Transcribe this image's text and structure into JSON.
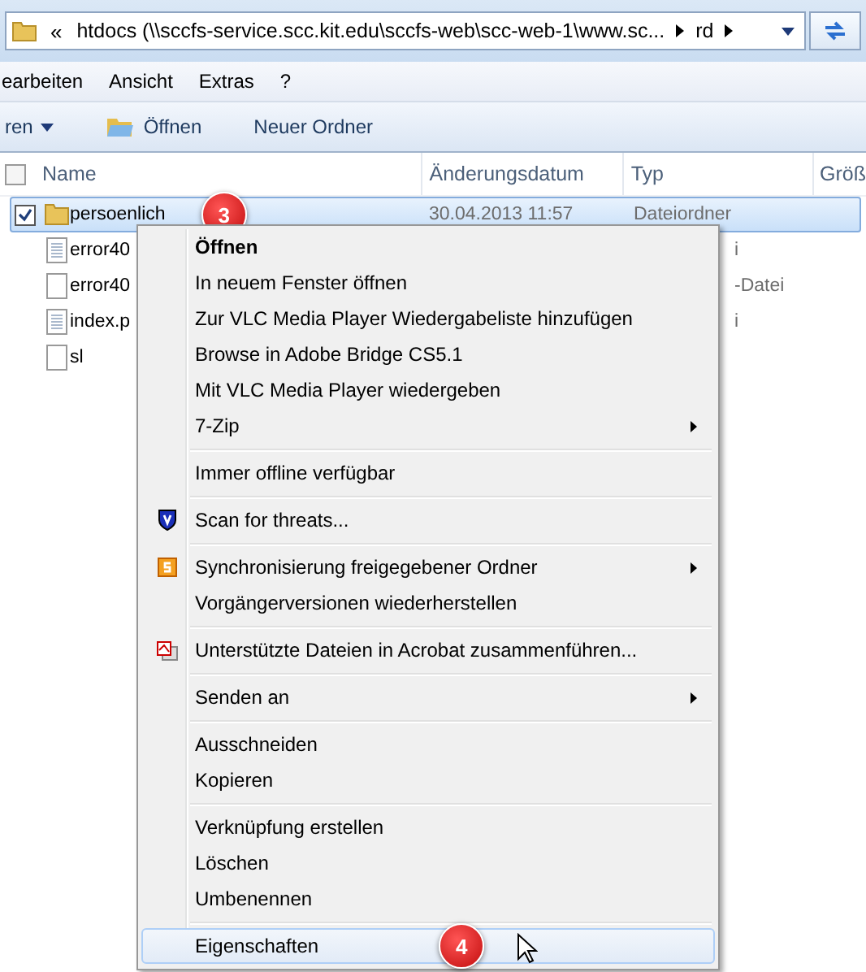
{
  "address_bar": {
    "back_chevron": "«",
    "path": "htdocs (\\\\sccfs-service.scc.kit.edu\\sccfs-web\\scc-web-1\\www.sc...",
    "crumbs": [
      "rd"
    ]
  },
  "menu_bar": [
    "earbeiten",
    "Ansicht",
    "Extras",
    "?"
  ],
  "toolbar": [
    {
      "label": "ren",
      "kind": "dropdown"
    },
    {
      "label": "Öffnen",
      "kind": "open"
    },
    {
      "label": "Neuer Ordner",
      "kind": "plain"
    }
  ],
  "header_checkbox": {
    "checked": false
  },
  "columns": [
    "Name",
    "Änderungsdatum",
    "Typ",
    "Größ"
  ],
  "rows": [
    {
      "name": "persoenlich",
      "date": "30.04.2013 11:57",
      "type": "Dateiordner",
      "kind": "folder",
      "selected": true,
      "checked": true,
      "badge": "3"
    },
    {
      "name": "error40",
      "type_tail": "i",
      "kind": "lines",
      "selected": false,
      "checked": false
    },
    {
      "name": "error40",
      "type_tail": "-Datei",
      "kind": "blank",
      "selected": false,
      "checked": false
    },
    {
      "name": "index.p",
      "type_tail": "i",
      "kind": "lines",
      "selected": false,
      "checked": false
    },
    {
      "name": "sl",
      "kind": "blank",
      "selected": false,
      "checked": false
    }
  ],
  "context_menu": [
    {
      "kind": "item",
      "label": "Öffnen",
      "default": true,
      "submenu": false,
      "selected": false
    },
    {
      "kind": "item",
      "label": "In neuem Fenster öffnen",
      "default": false,
      "submenu": false,
      "selected": false
    },
    {
      "kind": "item",
      "label": "Zur VLC Media Player Wiedergabeliste hinzufügen",
      "default": false,
      "submenu": false,
      "selected": false
    },
    {
      "kind": "item",
      "label": "Browse in Adobe Bridge CS5.1",
      "default": false,
      "submenu": false,
      "selected": false
    },
    {
      "kind": "item",
      "label": "Mit VLC Media Player wiedergeben",
      "default": false,
      "submenu": false,
      "selected": false
    },
    {
      "kind": "item",
      "label": "7-Zip",
      "default": false,
      "submenu": true,
      "selected": false
    },
    {
      "kind": "separator"
    },
    {
      "kind": "item",
      "label": "Immer offline verfügbar",
      "default": false,
      "submenu": false,
      "selected": false
    },
    {
      "kind": "separator"
    },
    {
      "kind": "shield",
      "label": "Scan for threats...",
      "default": false,
      "submenu": false,
      "selected": false
    },
    {
      "kind": "separator"
    },
    {
      "kind": "sync",
      "label": "Synchronisierung freigegebener Ordner",
      "default": false,
      "submenu": true,
      "selected": false
    },
    {
      "kind": "item",
      "label": "Vorgängerversionen wiederherstellen",
      "default": false,
      "submenu": false,
      "selected": false
    },
    {
      "kind": "separator"
    },
    {
      "kind": "acrobat",
      "label": "Unterstützte Dateien in Acrobat zusammenführen...",
      "default": false,
      "submenu": false,
      "selected": false
    },
    {
      "kind": "separator"
    },
    {
      "kind": "item",
      "label": "Senden an",
      "default": false,
      "submenu": true,
      "selected": false
    },
    {
      "kind": "separator"
    },
    {
      "kind": "item",
      "label": "Ausschneiden",
      "default": false,
      "submenu": false,
      "selected": false
    },
    {
      "kind": "item",
      "label": "Kopieren",
      "default": false,
      "submenu": false,
      "selected": false
    },
    {
      "kind": "separator"
    },
    {
      "kind": "item",
      "label": "Verknüpfung erstellen",
      "default": false,
      "submenu": false,
      "selected": false
    },
    {
      "kind": "item",
      "label": "Löschen",
      "default": false,
      "submenu": false,
      "selected": false
    },
    {
      "kind": "item",
      "label": "Umbenennen",
      "default": false,
      "submenu": false,
      "selected": false
    },
    {
      "kind": "separator"
    },
    {
      "kind": "item",
      "label": "Eigenschaften",
      "default": false,
      "submenu": false,
      "selected": true,
      "badge": "4"
    }
  ]
}
